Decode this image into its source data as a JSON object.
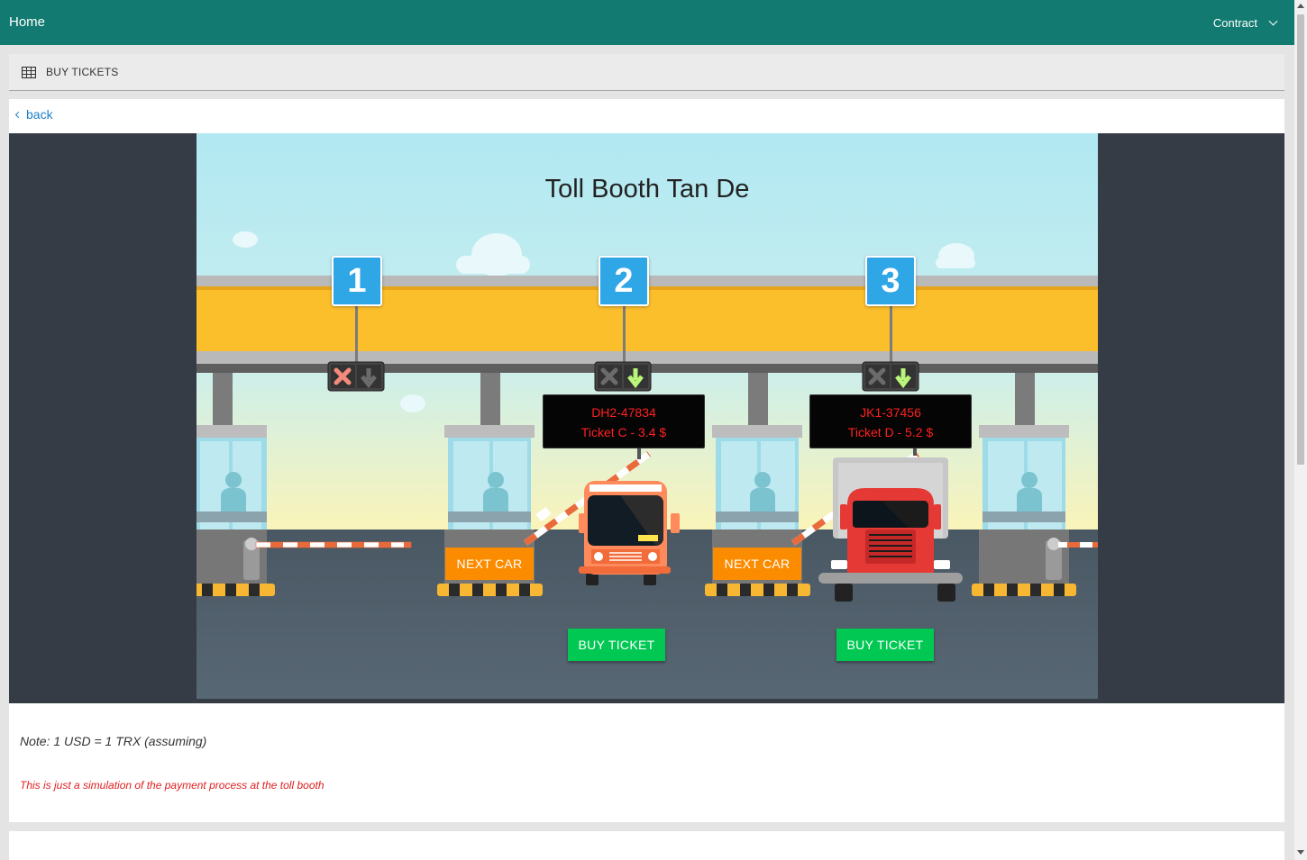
{
  "nav": {
    "home": "Home",
    "contract": "Contract"
  },
  "subheader": {
    "title": "BUY TICKETS",
    "icon": "table-grid-icon"
  },
  "back": {
    "label": "back",
    "icon": "chevron-left-icon"
  },
  "scene": {
    "title": "Toll Booth Tan De",
    "lanes": [
      {
        "number": "1",
        "signal": "closed"
      },
      {
        "number": "2",
        "signal": "open",
        "plate": "DH2-47834",
        "ticket": "Ticket C - 3.4 $",
        "vehicle": "bus",
        "next_label": "NEXT CAR",
        "buy_label": "BUY TICKET"
      },
      {
        "number": "3",
        "signal": "open",
        "plate": "JK1-37456",
        "ticket": "Ticket D - 5.2 $",
        "vehicle": "truck",
        "next_label": "NEXT CAR",
        "buy_label": "BUY TICKET"
      }
    ],
    "colors": {
      "sky": "#b3e9f1",
      "canopy": "#fbbf2c",
      "road": "#4d5c68",
      "next_button": "#fb8c00",
      "buy_button": "#00c853",
      "lane_number": "#2fa6e6"
    }
  },
  "note": "Note: 1 USD = 1 TRX (assuming)",
  "disclaimer": "This is just a simulation of the payment process at the toll booth"
}
